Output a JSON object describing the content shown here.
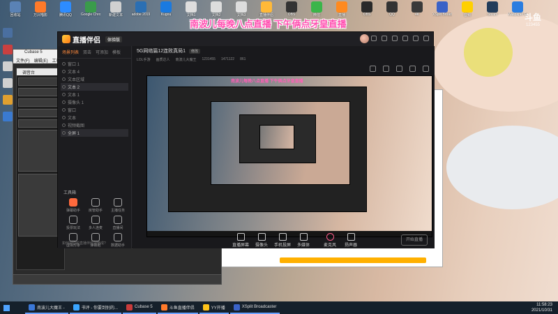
{
  "desktop": {
    "banner": "南波儿每晚八点直播 下午俩点牙皇直播",
    "watermark": {
      "logo": "斗鱼",
      "id": "123455"
    },
    "icons": [
      {
        "label": "回收站",
        "color": "#5a82b5"
      },
      {
        "label": "万兴喵影",
        "color": "#ff7a2a"
      },
      {
        "label": "腾讯QQ",
        "color": "#2d8cff"
      },
      {
        "label": "Google Chrome",
        "color": "#3a9b4b"
      },
      {
        "label": "新建文本",
        "color": "#d0d0d0"
      },
      {
        "label": "adobe 2019",
        "color": "#2b6fb3"
      },
      {
        "label": "Kugou",
        "color": "#1a7ae0"
      },
      {
        "label": "文档1",
        "color": "#dddddd"
      },
      {
        "label": "文档2",
        "color": "#dddddd"
      },
      {
        "label": "文档3",
        "color": "#dddddd"
      },
      {
        "label": "直播伴侣",
        "color": "#ffb938"
      },
      {
        "label": "OBS",
        "color": "#333333"
      },
      {
        "label": "微信",
        "color": "#3bb54a"
      },
      {
        "label": "直播",
        "color": "#ff8a1f"
      },
      {
        "label": "OBS",
        "color": "#2a2a2a"
      },
      {
        "label": "QQ",
        "color": "#333"
      },
      {
        "label": "4K",
        "color": "#3a3a3a"
      },
      {
        "label": "XSplit Broadcaster",
        "color": "#3a62c7"
      },
      {
        "label": "音频",
        "color": "#ffd000"
      },
      {
        "label": "Steam",
        "color": "#223c5a"
      },
      {
        "label": "Wallpaper Engine",
        "color": "#2b7de0"
      }
    ]
  },
  "cubase": {
    "title": "Cubase 5",
    "menu": [
      "文件(F)",
      "编辑(E)",
      "工程(P)"
    ],
    "subwindow": "调音台"
  },
  "app": {
    "logo": "直播伴侣",
    "version": "体验版",
    "left_tabs": [
      "场景列表",
      "双击",
      "可添加",
      "模板"
    ],
    "scenes": [
      {
        "name": "窗口 1",
        "selected": false
      },
      {
        "name": "文本 4",
        "selected": false
      },
      {
        "name": "文本区域",
        "selected": false
      },
      {
        "name": "文本 2",
        "selected": true
      },
      {
        "name": "文本 1",
        "selected": false
      },
      {
        "name": "摄像头 1",
        "selected": false
      },
      {
        "name": "窗口",
        "selected": false
      },
      {
        "name": "文本",
        "selected": false
      },
      {
        "name": "视频截图",
        "selected": false
      },
      {
        "name": "全屏 1",
        "selected": true
      }
    ],
    "tools_title": "工具箱",
    "tools": [
      {
        "label": "弹幕助手",
        "hot": true
      },
      {
        "label": "房管助手",
        "hot": false
      },
      {
        "label": "主播任务",
        "hot": false
      },
      {
        "label": "投票玩法",
        "hot": false
      },
      {
        "label": "多人连麦",
        "hot": false
      },
      {
        "label": "直播间",
        "hot": false
      },
      {
        "label": "虚拟形象",
        "hot": false
      },
      {
        "label": "弹幕姬",
        "hot": false
      },
      {
        "label": "数据助手",
        "hot": false
      }
    ],
    "hint": "如何把你的直播伴侣调整成?",
    "stream_title": "5G网络篇12连败真局1",
    "title_tag": "修改",
    "meta": [
      "LOL手游",
      "画质达人",
      "南波儿大魔王",
      "1231455",
      "1471122",
      "861"
    ],
    "bottom_tools": [
      {
        "label": "直播屏幕",
        "mic": false
      },
      {
        "label": "摄像头",
        "mic": false
      },
      {
        "label": "手机投屏",
        "mic": false
      },
      {
        "label": "多媒体",
        "mic": false
      },
      {
        "label": "麦克风",
        "mic": true
      },
      {
        "label": "扬声器",
        "mic": false
      }
    ],
    "start_label": "开始直播"
  },
  "taskbar": {
    "apps": [
      {
        "label": "南波儿大魔王 -",
        "color": "#3b78d8"
      },
      {
        "label": "书评 - 你要到别的...",
        "color": "#3aa5ff"
      },
      {
        "label": "Cubase 5",
        "color": "#c93b3b"
      },
      {
        "label": "斗鱼直播伴侣",
        "color": "#ff7a2a"
      },
      {
        "label": "YY开播",
        "color": "#ffc31a"
      },
      {
        "label": "XSplit Broadcaster",
        "color": "#3a62c7"
      }
    ],
    "time": "11:58:23",
    "date": "2021/10/31"
  }
}
